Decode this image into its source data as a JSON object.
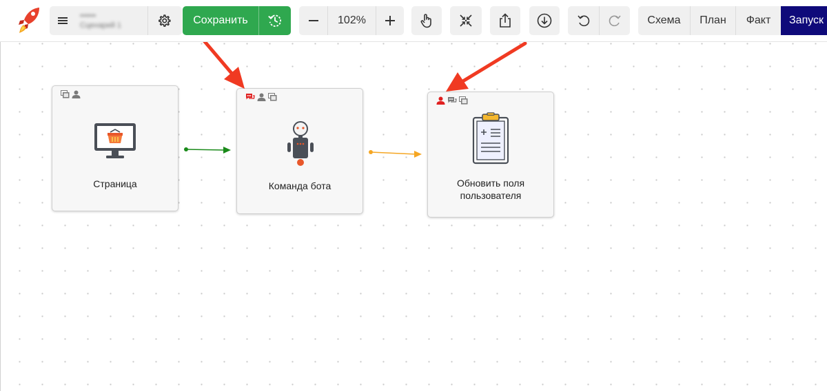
{
  "toolbar": {
    "logo_icon": "rocket-icon",
    "menu_icon": "hamburger-icon",
    "scenario_name_line1": "••••••",
    "scenario_name_line2": "Сценарий 1",
    "settings_icon": "gear-icon",
    "save_label": "Сохранить",
    "history_icon": "clock-history-icon",
    "zoom_out_icon": "minus-icon",
    "zoom_value": "102%",
    "zoom_in_icon": "plus-icon",
    "pan_icon": "hand-pointer-icon",
    "fit_icon": "collapse-arrows-icon",
    "export_icon": "share-upload-icon",
    "download_icon": "download-circle-icon",
    "undo_icon": "undo-icon",
    "redo_icon": "redo-icon",
    "tabs": [
      "Схема",
      "План",
      "Факт"
    ],
    "run_label": "Запуск"
  },
  "colors": {
    "save_green": "#2fa84f",
    "run_navy": "#0f0a7a",
    "edge_green": "#1a8a1a",
    "edge_orange": "#f5a623",
    "annotation_red": "#f03a22",
    "badge_red": "#e02020",
    "badge_gray": "#7a7a7a"
  },
  "nodes": [
    {
      "id": "page",
      "title": "Страница",
      "icon": "monitor-basket-icon",
      "badges": [
        "screens-icon",
        "user-icon"
      ]
    },
    {
      "id": "bot",
      "title": "Команда бота",
      "icon": "robot-icon",
      "badges": [
        "chat-icon",
        "user-icon",
        "screens-icon"
      ]
    },
    {
      "id": "update",
      "title": "Обновить поля\nпользователя",
      "icon": "clipboard-icon",
      "badges": [
        "user-icon",
        "chat-icon",
        "screens-icon"
      ]
    }
  ],
  "edges": [
    {
      "from": "page",
      "to": "bot",
      "color": "#1a8a1a"
    },
    {
      "from": "bot",
      "to": "update",
      "color": "#f5a623"
    }
  ]
}
